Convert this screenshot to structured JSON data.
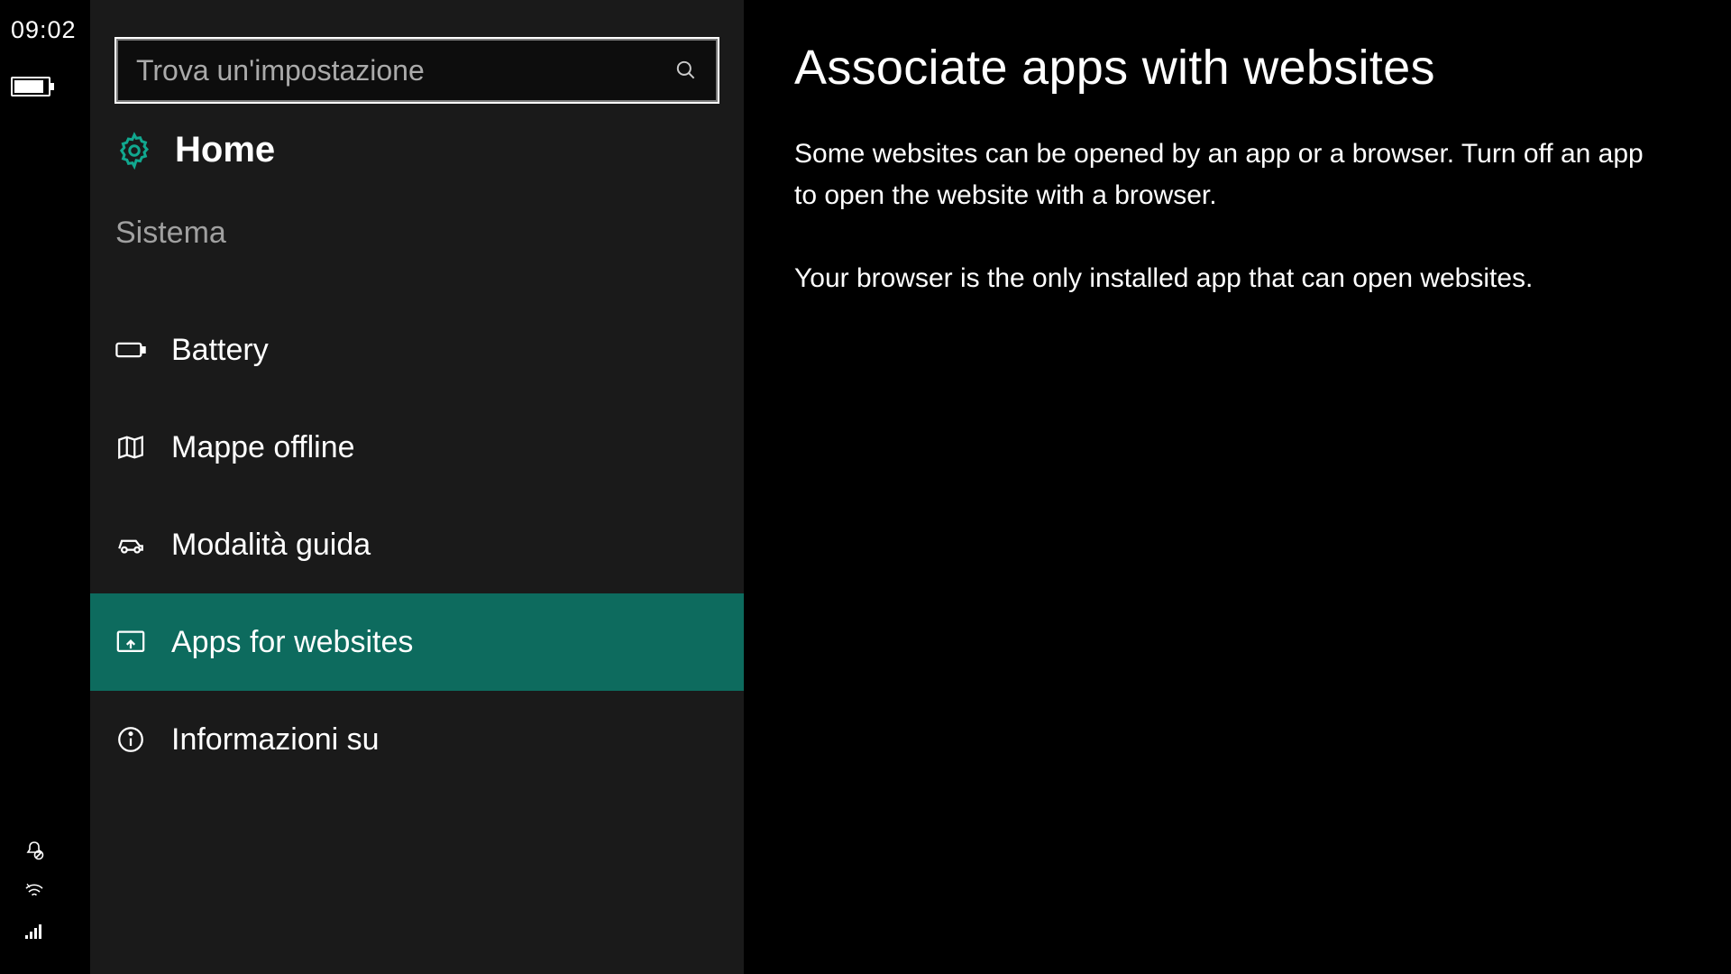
{
  "status": {
    "clock": "09:02"
  },
  "search": {
    "placeholder": "Trova un'impostazione"
  },
  "home": {
    "label": "Home"
  },
  "section": {
    "title": "Sistema"
  },
  "nav": {
    "items": [
      {
        "label": "Battery"
      },
      {
        "label": "Mappe offline"
      },
      {
        "label": "Modalità guida"
      },
      {
        "label": "Apps for websites"
      },
      {
        "label": "Informazioni su"
      }
    ]
  },
  "content": {
    "heading": "Associate apps with websites",
    "p1": "Some websites can be opened by an app or a browser.  Turn off an app to open the website with a browser.",
    "p2": "Your browser is the only installed app that can open websites."
  },
  "colors": {
    "accent": "#0d6b5e"
  }
}
